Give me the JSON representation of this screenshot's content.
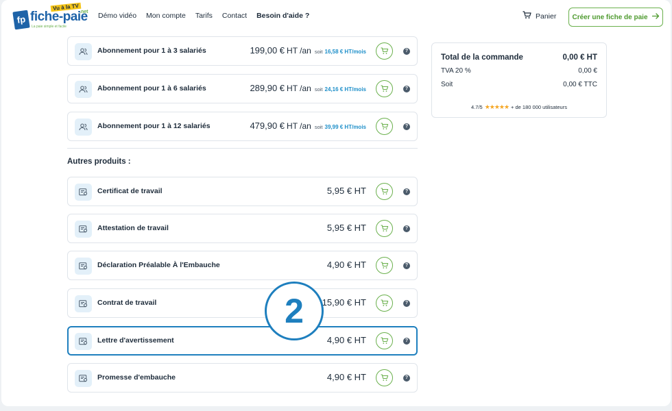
{
  "logo": {
    "short": "fp",
    "name": "fiche-paie",
    "tv": "Vu à la TV",
    "net": ".net",
    "tagline": "La paie simple et facile"
  },
  "nav": {
    "items": [
      "Démo vidéo",
      "Mon compte",
      "Tarifs",
      "Contact",
      "Besoin d'aide ?"
    ]
  },
  "header": {
    "cart_label": "Panier",
    "cta_label": "Créer une fiche de paie"
  },
  "subscriptions": [
    {
      "name": "Abonnement pour 1 à 3 salariés",
      "price": "199,00 €",
      "unit": "HT /an",
      "soit": "soit",
      "monthly": "16,58 € HT/mois"
    },
    {
      "name": "Abonnement pour 1 à 6 salariés",
      "price": "289,90 €",
      "unit": "HT /an",
      "soit": "soit",
      "monthly": "24,16 € HT/mois"
    },
    {
      "name": "Abonnement pour 1 à 12 salariés",
      "price": "479,90 €",
      "unit": "HT /an",
      "soit": "soit",
      "monthly": "39,99 € HT/mois"
    }
  ],
  "others": {
    "title": "Autres produits :",
    "items": [
      {
        "name": "Certificat de travail",
        "price": "5,95 € HT"
      },
      {
        "name": "Attestation de travail",
        "price": "5,95 € HT"
      },
      {
        "name": "Déclaration Préalable À l'Embauche",
        "price": "4,90 € HT"
      },
      {
        "name": "Contrat de travail",
        "price": "15,90 € HT"
      },
      {
        "name": "Lettre d'avertissement",
        "price": "4,90 € HT"
      },
      {
        "name": "Promesse d'embauche",
        "price": "4,90 € HT"
      }
    ]
  },
  "summary": {
    "total_label": "Total de la commande",
    "total_value": "0,00 € HT",
    "tva_label": "TVA 20 %",
    "tva_value": "0,00 €",
    "soit_label": "Soit",
    "soit_value": "0,00 € TTC",
    "rating": "4.7/5",
    "stars": "★★★★★",
    "users": "+ de 180 000 utilisateurs"
  },
  "badge": {
    "number": "2"
  },
  "colors": {
    "brand_blue": "#1e63a8",
    "accent_green": "#6ab04c",
    "highlight_blue": "#1e7fbe",
    "link_blue": "#1e8fc9"
  },
  "icons": {
    "user_group": "users-icon",
    "document": "document-icon",
    "cart": "cart-icon",
    "help": "help-icon",
    "arrow": "arrow-right-icon"
  }
}
